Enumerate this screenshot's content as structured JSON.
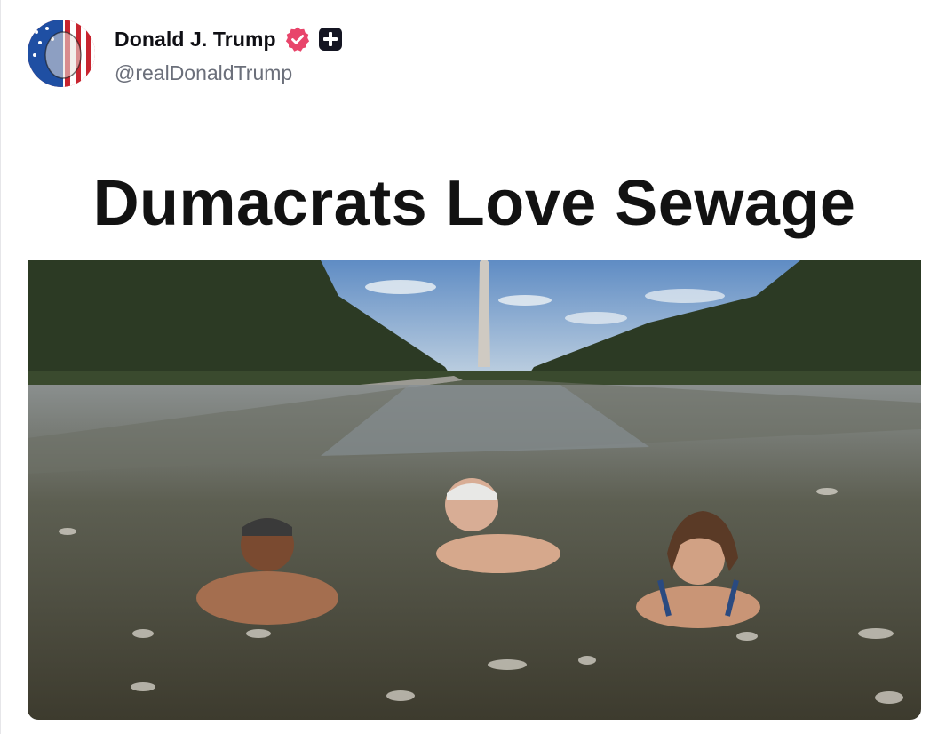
{
  "post": {
    "author": {
      "display_name": "Donald J. Trump",
      "handle": "@realDonaldTrump",
      "avatar_icon": "flag-portrait-avatar",
      "verified_icon": "verified-badge-icon",
      "extra_badge_icon": "plus-badge-icon",
      "verified_color": "#e8456b"
    },
    "image": {
      "headline": "Dumacrats Love Sewage"
    }
  }
}
